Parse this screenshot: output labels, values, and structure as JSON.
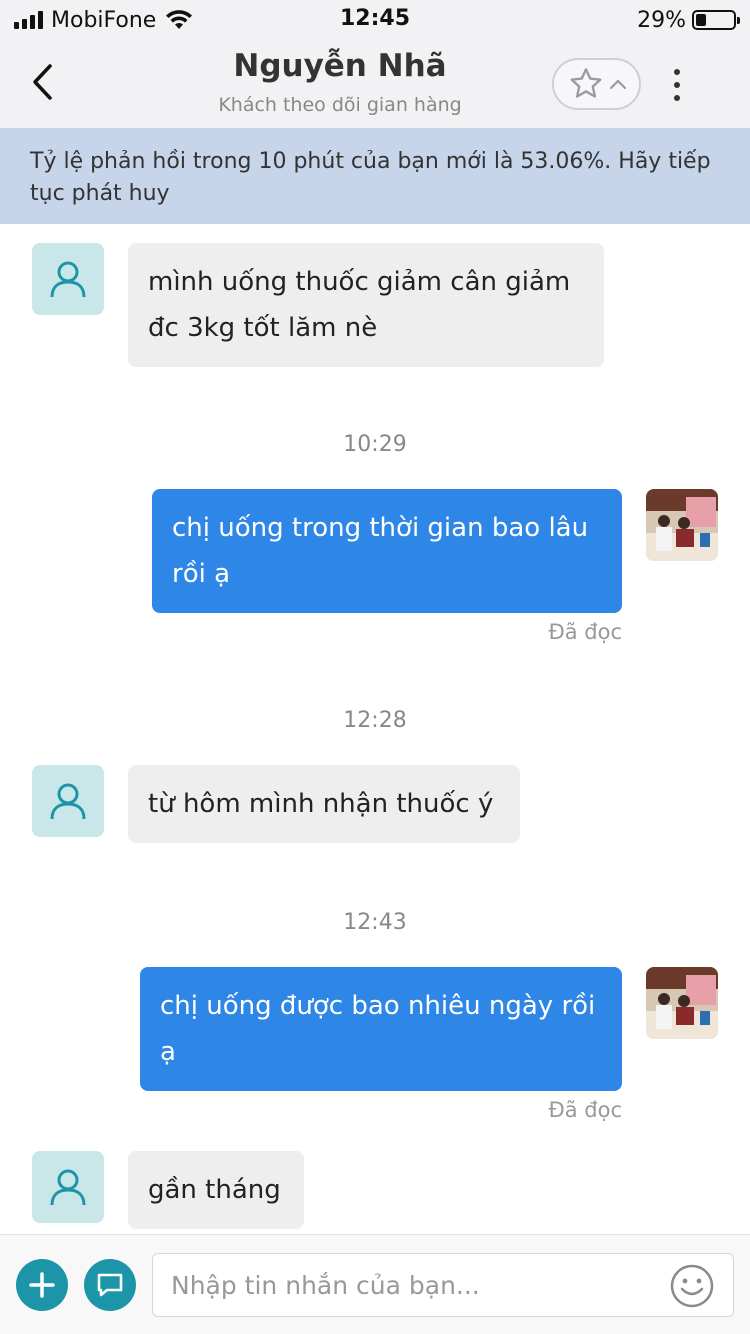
{
  "status_bar": {
    "carrier": "MobiFone",
    "time": "12:45",
    "battery_percent_label": "29%",
    "battery_level": 0.29
  },
  "header": {
    "title": "Nguyễn Nhã",
    "subtitle": "Khách theo dõi gian hàng",
    "back_icon": "chevron-left-icon",
    "star_icon": "star-icon",
    "expand_icon": "chevron-up-icon",
    "more_icon": "more-vertical-icon"
  },
  "banner": {
    "text": "Tỷ lệ phản hồi trong 10 phút của bạn mới là 53.06%. Hãy tiếp tục phát huy"
  },
  "messages": [
    {
      "direction": "in",
      "lines": [
        "mình uống thuốc giảm cân giảm",
        "đc 3kg tốt lăm nè"
      ]
    },
    {
      "type": "timestamp",
      "text": "10:29"
    },
    {
      "direction": "out",
      "lines": [
        "chị uống trong thời gian bao lâu",
        "rồi ạ"
      ],
      "status": "Đã đọc"
    },
    {
      "type": "timestamp",
      "text": "12:28"
    },
    {
      "direction": "in",
      "lines": [
        "từ hôm mình nhận thuốc ý"
      ]
    },
    {
      "type": "timestamp",
      "text": "12:43"
    },
    {
      "direction": "out",
      "lines": [
        "chị uống được bao nhiêu ngày rồi",
        "ạ"
      ],
      "status": "Đã đọc"
    },
    {
      "direction": "in",
      "lines": [
        "gần tháng"
      ]
    }
  ],
  "input_bar": {
    "placeholder": "Nhập tin nhắn của bạn...",
    "value": "",
    "plus_icon": "plus-icon",
    "chat_icon": "chat-bubble-icon",
    "emoji_icon": "emoji-icon"
  },
  "colors": {
    "header_bg": "#f2f2f4",
    "banner_bg": "#c6d5ea",
    "outgoing_bubble": "#2e86e6",
    "incoming_bubble": "#eeeeef",
    "avatar_bg": "#c9e6e8",
    "accent": "#1c95a8"
  }
}
